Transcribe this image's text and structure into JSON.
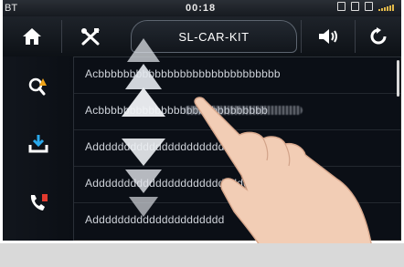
{
  "status_bar": {
    "left": "BT",
    "time": "00:18"
  },
  "toolbar": {
    "title": "SL-CAR-KIT"
  },
  "contacts": [
    {
      "name": "Acbbbbbbbbbbbbbbbbbbbbbbbbbbbbb"
    },
    {
      "name": "Acbbbbbbbbbbbbbbbbbbbbbbbbbbb"
    },
    {
      "name": "Adddddddddddddddddddddddddddd"
    },
    {
      "name": "Addddddddddddddddddddddddd"
    },
    {
      "name": "Addddddddddddddddddddd"
    }
  ],
  "colors": {
    "accent": "#f0a418",
    "screen_bg": "#0b0f16"
  }
}
